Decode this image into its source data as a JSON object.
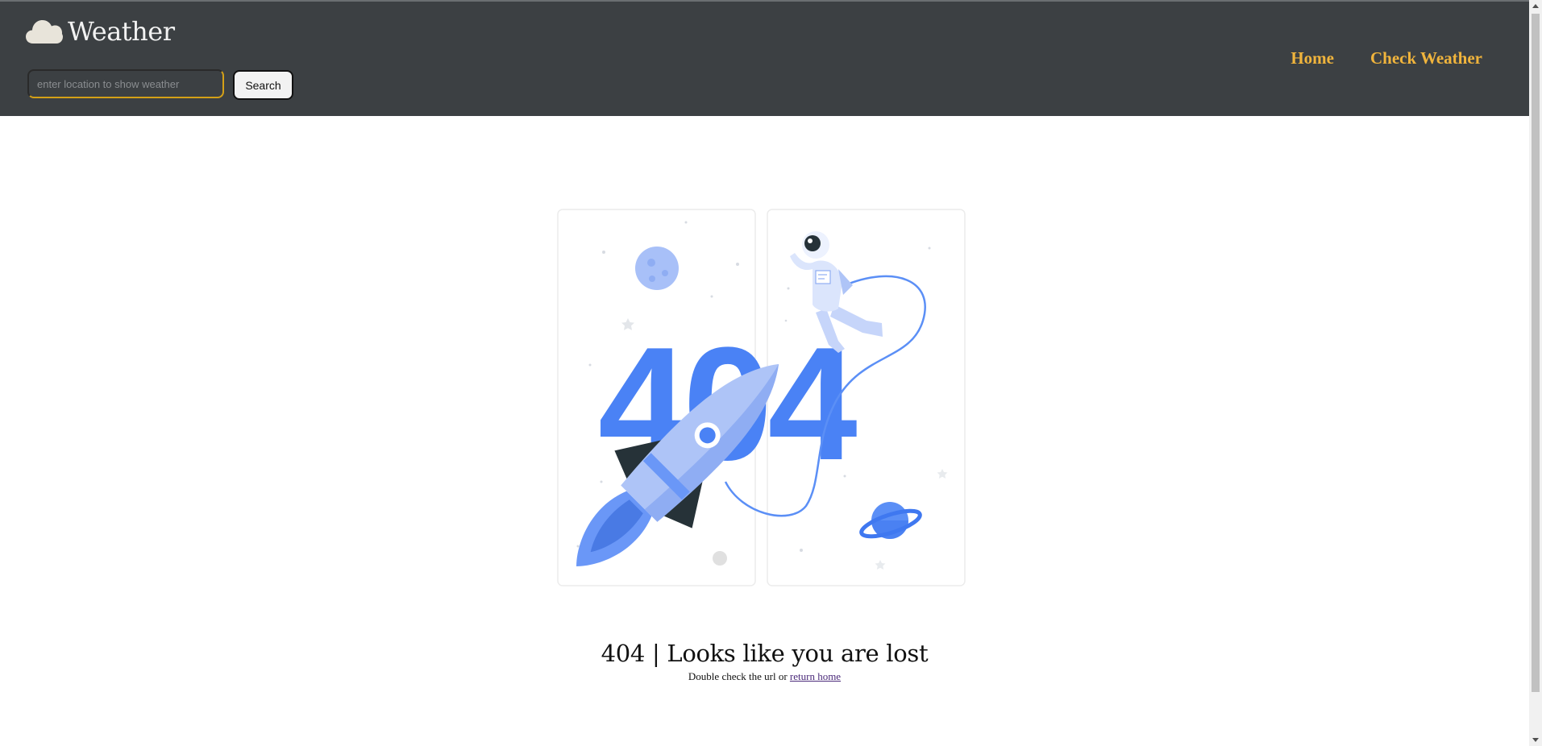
{
  "app": {
    "title": "Weather",
    "icon": "cloud-icon"
  },
  "search": {
    "placeholder": "enter location to show weather",
    "value": "",
    "button_label": "Search"
  },
  "nav": {
    "items": [
      {
        "label": "Home"
      },
      {
        "label": "Check Weather"
      }
    ]
  },
  "illustration": {
    "text": "404",
    "icons": [
      "rocket-icon",
      "astronaut-icon",
      "moon-icon",
      "planet-icon"
    ]
  },
  "error": {
    "heading": "404 | Looks like you are lost",
    "subtext": "Double check the url or ",
    "link_label": "return home"
  },
  "colors": {
    "header_bg": "#3c4043",
    "nav_link": "#f0b43c",
    "accent_blue": "#4285f4",
    "light_blue": "#aec4f7",
    "dark_navy": "#263238"
  }
}
